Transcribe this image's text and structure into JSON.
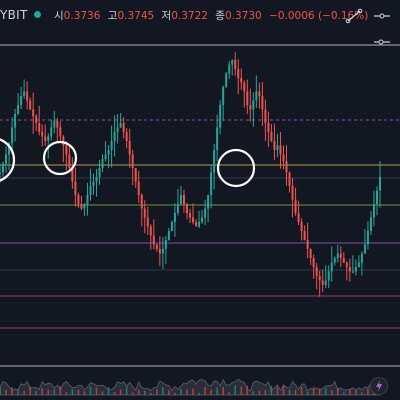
{
  "header": {
    "symbol": "YBIT",
    "open_label": "시",
    "open_value": "0.3736",
    "high_label": "고",
    "high_value": "0.3745",
    "low_label": "저",
    "low_value": "0.3722",
    "close_label": "종",
    "close_value": "0.3730",
    "change": "−0.0006 (−0.16%)"
  },
  "toolbar": {
    "icons": [
      "drawing-tool-icon",
      "horizontal-line-tool-icon",
      "horizontal-ray-tool-icon"
    ]
  },
  "colors": {
    "background": "#131722",
    "up": "#26a69a",
    "down": "#ef5350",
    "yellow": "#e8c858",
    "purple": "#a06ad0",
    "pink": "#d24a7a",
    "white": "#e8e8e8",
    "lime": "#8bc34a"
  },
  "chart_data": {
    "type": "candlestick",
    "horizontal_levels": [
      {
        "color": "white",
        "style": "solid"
      },
      {
        "color": "purple",
        "style": "dashed"
      },
      {
        "color": "yellow",
        "style": "solid"
      },
      {
        "color": "lime",
        "style": "solid"
      },
      {
        "color": "purple",
        "style": "solid"
      },
      {
        "color": "pink",
        "style": "solid"
      },
      {
        "color": "pink",
        "style": "solid"
      },
      {
        "color": "white",
        "style": "solid"
      }
    ],
    "highlight_circles": 3,
    "price_path": [
      0.5,
      0.54,
      0.58,
      0.63,
      0.7,
      0.76,
      0.8,
      0.84,
      0.86,
      0.82,
      0.78,
      0.75,
      0.72,
      0.68,
      0.66,
      0.64,
      0.66,
      0.7,
      0.73,
      0.7,
      0.66,
      0.62,
      0.58,
      0.52,
      0.46,
      0.4,
      0.36,
      0.34,
      0.36,
      0.4,
      0.44,
      0.46,
      0.48,
      0.52,
      0.56,
      0.58,
      0.6,
      0.64,
      0.68,
      0.7,
      0.72,
      0.68,
      0.64,
      0.58,
      0.52,
      0.46,
      0.4,
      0.34,
      0.3,
      0.26,
      0.22,
      0.18,
      0.16,
      0.14,
      0.16,
      0.2,
      0.24,
      0.28,
      0.32,
      0.36,
      0.4,
      0.36,
      0.32,
      0.3,
      0.28,
      0.26,
      0.28,
      0.3,
      0.34,
      0.4,
      0.5,
      0.6,
      0.7,
      0.8,
      0.88,
      0.94,
      0.98,
      1.0,
      0.96,
      0.92,
      0.9,
      0.86,
      0.8,
      0.78,
      0.82,
      0.86,
      0.84,
      0.78,
      0.72,
      0.68,
      0.64,
      0.6,
      0.62,
      0.58,
      0.55,
      0.5,
      0.44,
      0.38,
      0.32,
      0.28,
      0.24,
      0.2,
      0.16,
      0.12,
      0.08,
      0.04,
      0.02,
      0.0,
      0.02,
      0.06,
      0.1,
      0.12,
      0.14,
      0.12,
      0.1,
      0.08,
      0.06,
      0.06,
      0.08,
      0.1,
      0.14,
      0.18,
      0.24,
      0.3,
      0.36,
      0.42,
      0.48
    ]
  }
}
